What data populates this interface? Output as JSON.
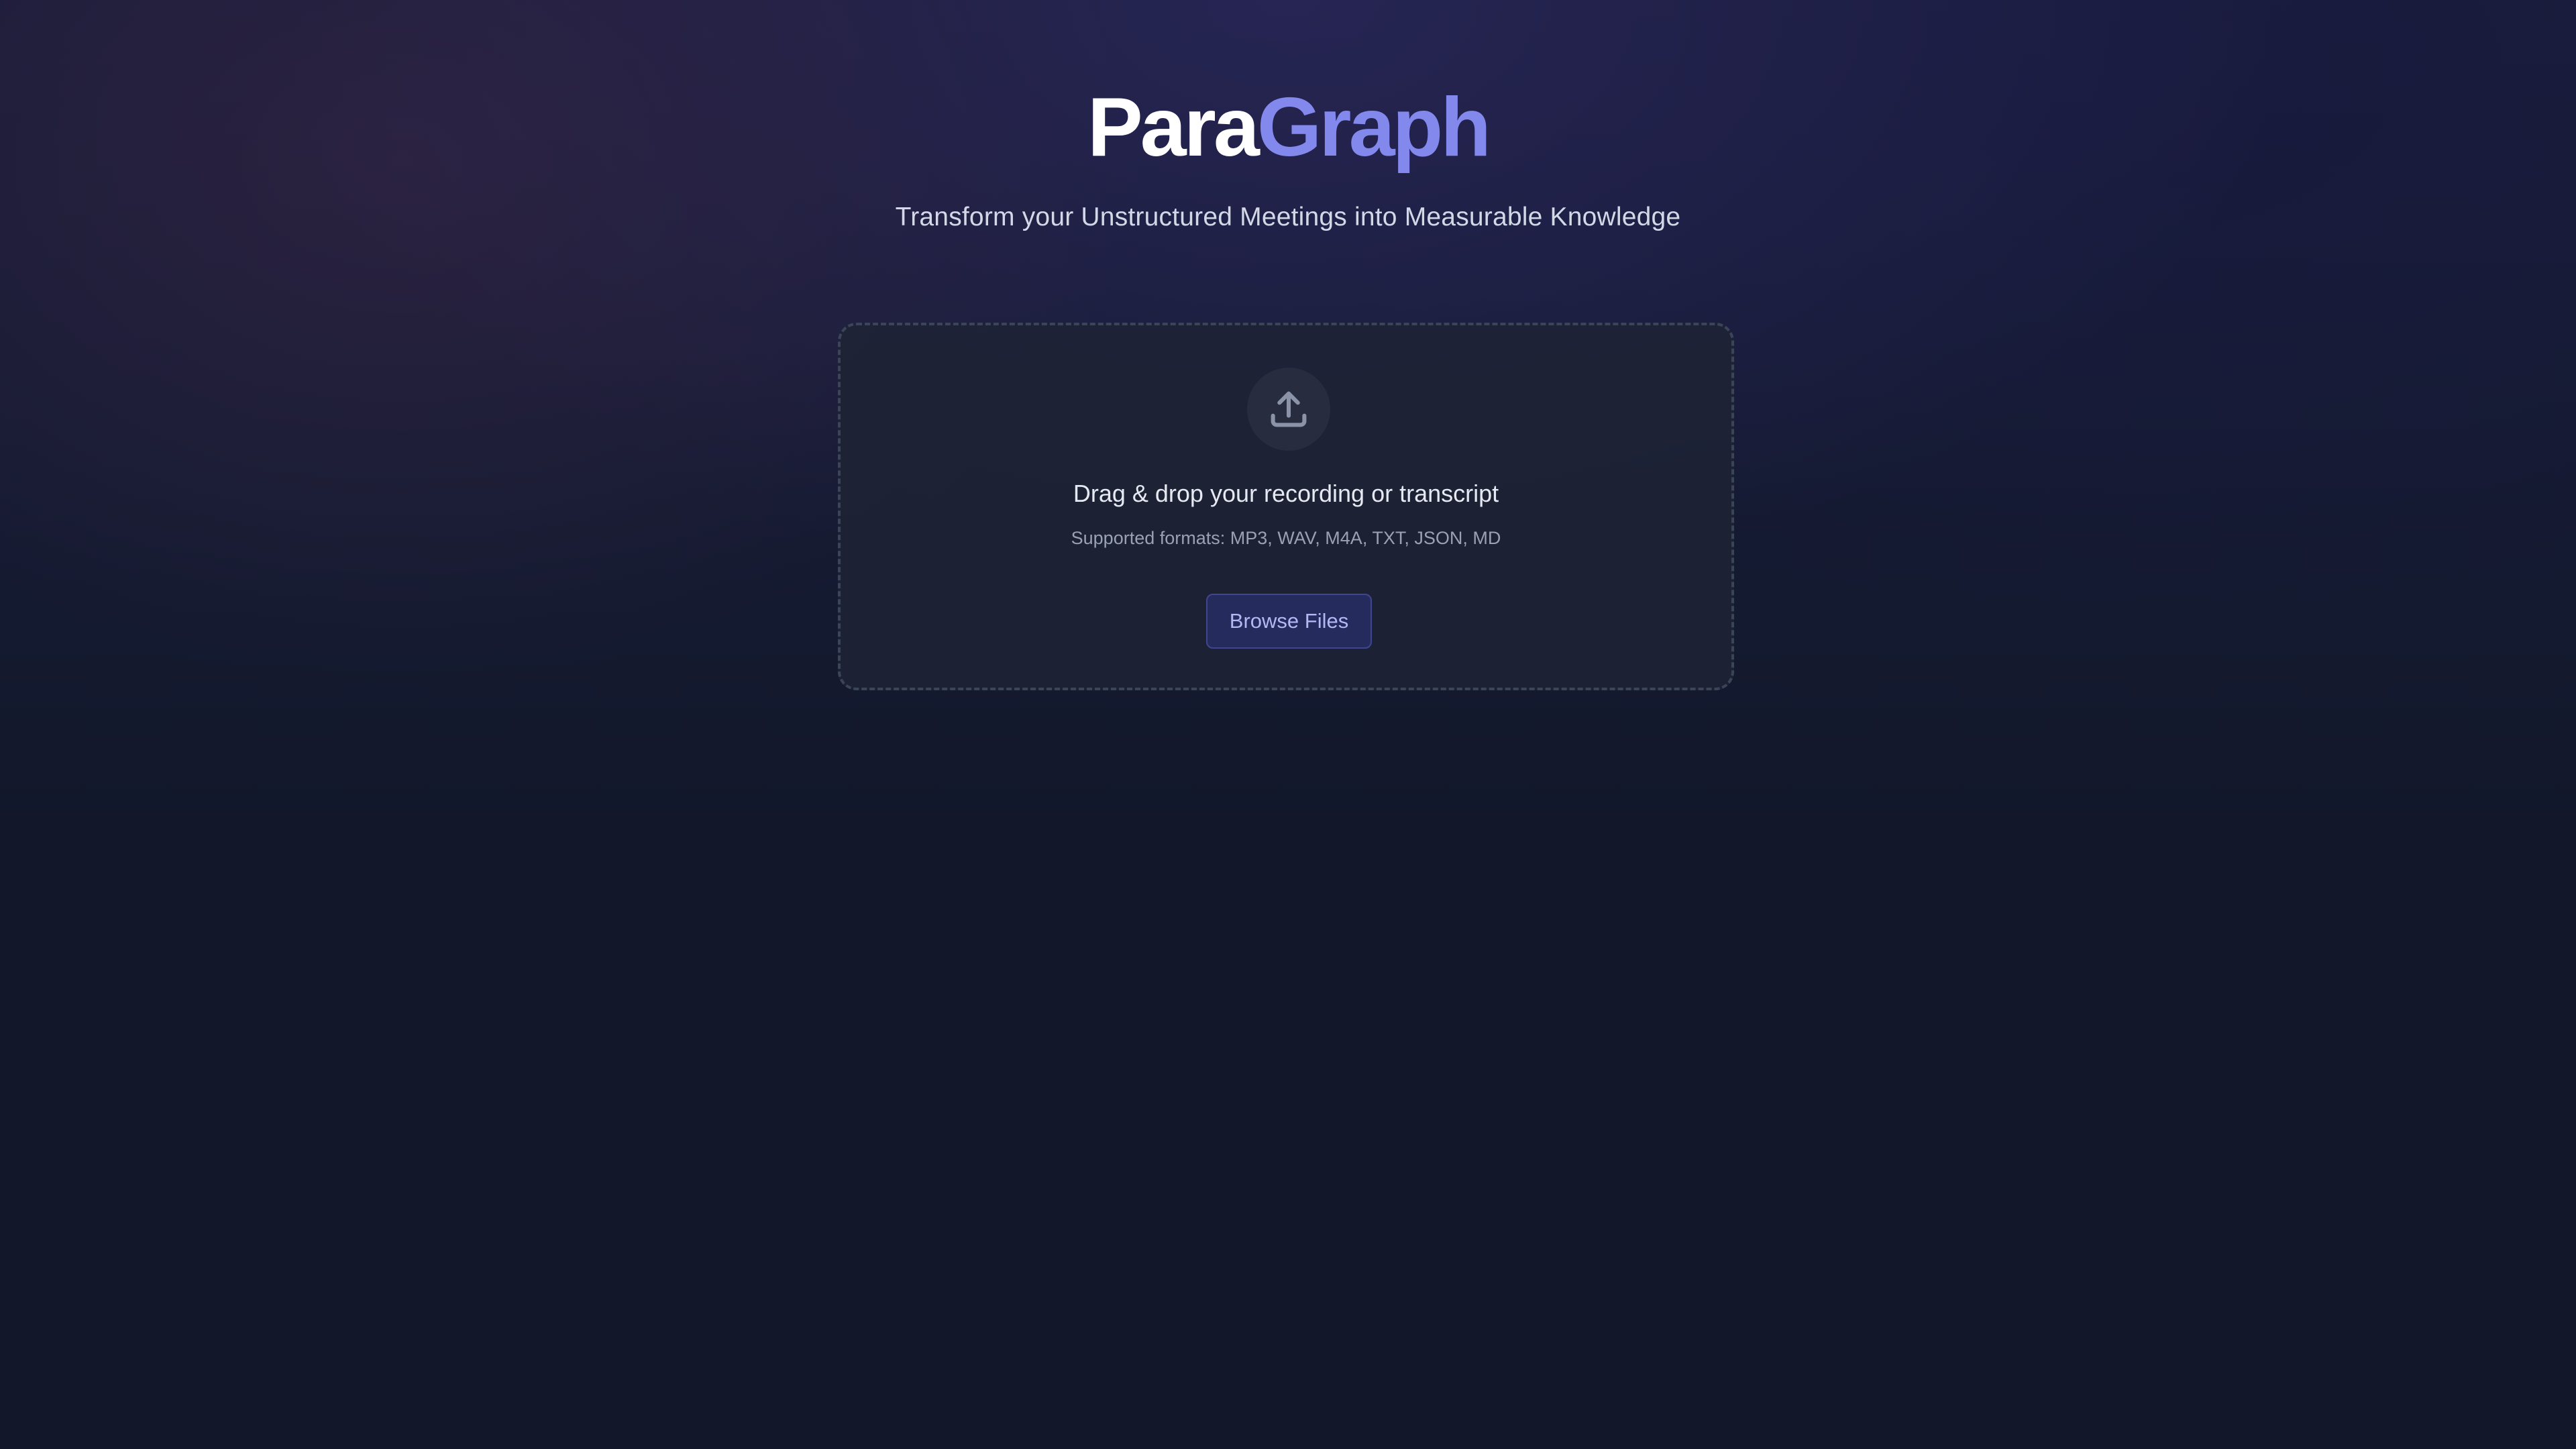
{
  "header": {
    "logo": {
      "part_a": "Para",
      "part_b": "Graph"
    },
    "tagline": "Transform your Unstructured Meetings into Measurable Knowledge"
  },
  "dropzone": {
    "icon": "upload-icon",
    "title": "Drag & drop your recording or transcript",
    "formats": "Supported formats: MP3, WAV, M4A, TXT, JSON, MD",
    "browse_label": "Browse Files"
  },
  "colors": {
    "background": "#121729",
    "accent": "#8288ec",
    "button_bg": "#262b5e",
    "button_text": "#b2b8f4"
  }
}
